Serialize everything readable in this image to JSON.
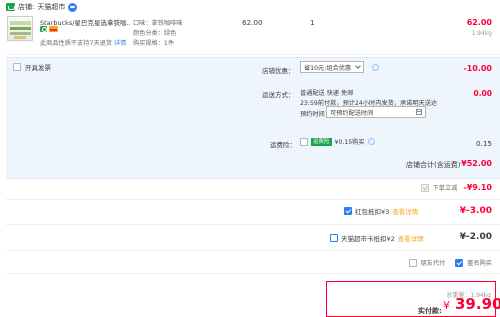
{
  "shop": {
    "label": "店铺:",
    "name": "天猫超市",
    "icon": "shop-icon",
    "chat_icon": "wangwang-chat-icon"
  },
  "product": {
    "title": "Starbucks/星巴克星选拿铁咖...",
    "note": "此商品性质不支持7天退货",
    "note_link": "详情",
    "specs": [
      "口味：拿铁咖啡味",
      "颜色分类：绿色",
      "购买规格：1件"
    ],
    "unit_price": "62.00",
    "quantity": "1",
    "total": "62.00",
    "weight": "1.94kg"
  },
  "panel": {
    "invoice_label": "开具发票",
    "promo_label": "店铺优惠：",
    "promo_select": "省10元:组合优惠",
    "promo_amount": "-10.00",
    "ship_label": "运送方式：",
    "ship_line1": "普通配送 快递 免邮",
    "ship_line2": "23:59前付款，预计24小时内发货，承诺明天送达",
    "ship_line3": "预约时间",
    "ship_time_placeholder": "可预约配送时间",
    "ship_amount": "0.00",
    "insurance_label": "运费险：",
    "insurance_tag": "运费险",
    "insurance_text": "¥0.15购买",
    "insurance_amount": "0.15",
    "shop_total_label": "店铺合计(含运费)",
    "shop_total_amount": "¥52.00"
  },
  "discount": {
    "label": "下单立减",
    "amount": "-¥9.10"
  },
  "red_packet": {
    "label": "红包抵扣¥3",
    "link": "查看详情",
    "amount": "¥-3.00"
  },
  "card": {
    "label": "天猫超市卡抵扣¥2",
    "link": "查看详情",
    "amount": "¥-2.00"
  },
  "pay_options": {
    "friend_pay": "朋友代付",
    "anonymous": "匿名购买"
  },
  "summary": {
    "weight": "总重量：1.94kg",
    "pay_label": "实付款:",
    "currency": "¥",
    "amount": "39.90"
  },
  "colors": {
    "accent_red": "#ff0036",
    "accent_blue": "#2d7ff5",
    "panel_bg": "#eef5fc",
    "link_orange": "#f5a623"
  }
}
